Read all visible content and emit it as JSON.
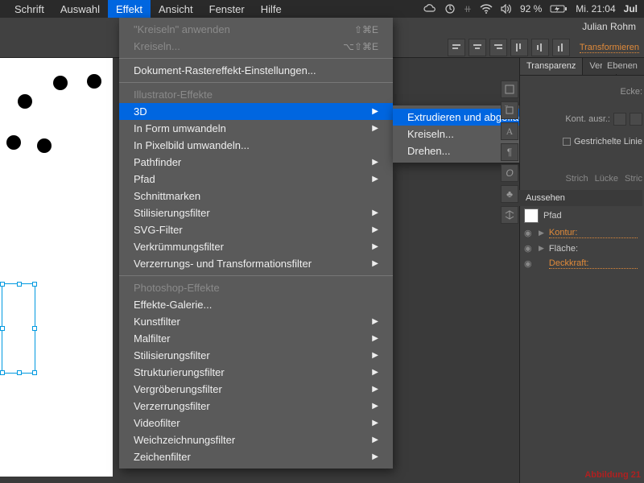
{
  "menubar": {
    "items": [
      "Schrift",
      "Auswahl",
      "Effekt",
      "Ansicht",
      "Fenster",
      "Hilfe"
    ],
    "selected_index": 2,
    "status": {
      "battery": "92 %",
      "clock": "Mi. 21:04",
      "user": "Jul"
    }
  },
  "header": {
    "username": "Julian Rohm",
    "transformieren": "Transformieren"
  },
  "menu": {
    "recent": {
      "apply": "\"Kreiseln\" anwenden",
      "apply_shortcut": "⇧⌘E",
      "repeat": "Kreiseln...",
      "repeat_shortcut": "⌥⇧⌘E"
    },
    "doc_raster": "Dokument-Rastereffekt-Einstellungen...",
    "section1_header": "Illustrator-Effekte",
    "section1": [
      {
        "label": "3D",
        "arrow": true,
        "hl": true
      },
      {
        "label": "In Form umwandeln",
        "arrow": true
      },
      {
        "label": "In Pixelbild umwandeln..."
      },
      {
        "label": "Pathfinder",
        "arrow": true
      },
      {
        "label": "Pfad",
        "arrow": true
      },
      {
        "label": "Schnittmarken"
      },
      {
        "label": "Stilisierungsfilter",
        "arrow": true
      },
      {
        "label": "SVG-Filter",
        "arrow": true
      },
      {
        "label": "Verkrümmungsfilter",
        "arrow": true
      },
      {
        "label": "Verzerrungs- und Transformationsfilter",
        "arrow": true
      }
    ],
    "section2_header": "Photoshop-Effekte",
    "section2": [
      {
        "label": "Effekte-Galerie..."
      },
      {
        "label": "Kunstfilter",
        "arrow": true
      },
      {
        "label": "Malfilter",
        "arrow": true
      },
      {
        "label": "Stilisierungsfilter",
        "arrow": true
      },
      {
        "label": "Strukturierungsfilter",
        "arrow": true
      },
      {
        "label": "Vergröberungsfilter",
        "arrow": true
      },
      {
        "label": "Verzerrungsfilter",
        "arrow": true
      },
      {
        "label": "Videofilter",
        "arrow": true
      },
      {
        "label": "Weichzeichnungsfilter",
        "arrow": true
      },
      {
        "label": "Zeichenfilter",
        "arrow": true
      }
    ]
  },
  "submenu": {
    "items": [
      {
        "label": "Extrudieren und abgeflachte Kante...",
        "hl": true
      },
      {
        "label": "Kreiseln..."
      },
      {
        "label": "Drehen..."
      }
    ]
  },
  "right": {
    "tabs": [
      "Transparenz",
      "Verla"
    ],
    "ecke": "Ecke:",
    "kont": "Kont. ausr.:",
    "gestrichelte": "Gestrichelte Linie",
    "stroke_tabs": [
      "Strich",
      "Lücke",
      "Stric"
    ],
    "aussehen": "Aussehen",
    "ebenen": "Ebenen",
    "appearance": [
      {
        "label": "Pfad",
        "swatch": true
      },
      {
        "label": "Kontur:",
        "link": true,
        "eye": true,
        "tri": true
      },
      {
        "label": "Fläche:",
        "eye": true,
        "tri": true
      },
      {
        "label": "Deckkraft:",
        "link": true,
        "eye": true
      }
    ]
  },
  "footer": {
    "abb": "Abbildung 21"
  }
}
